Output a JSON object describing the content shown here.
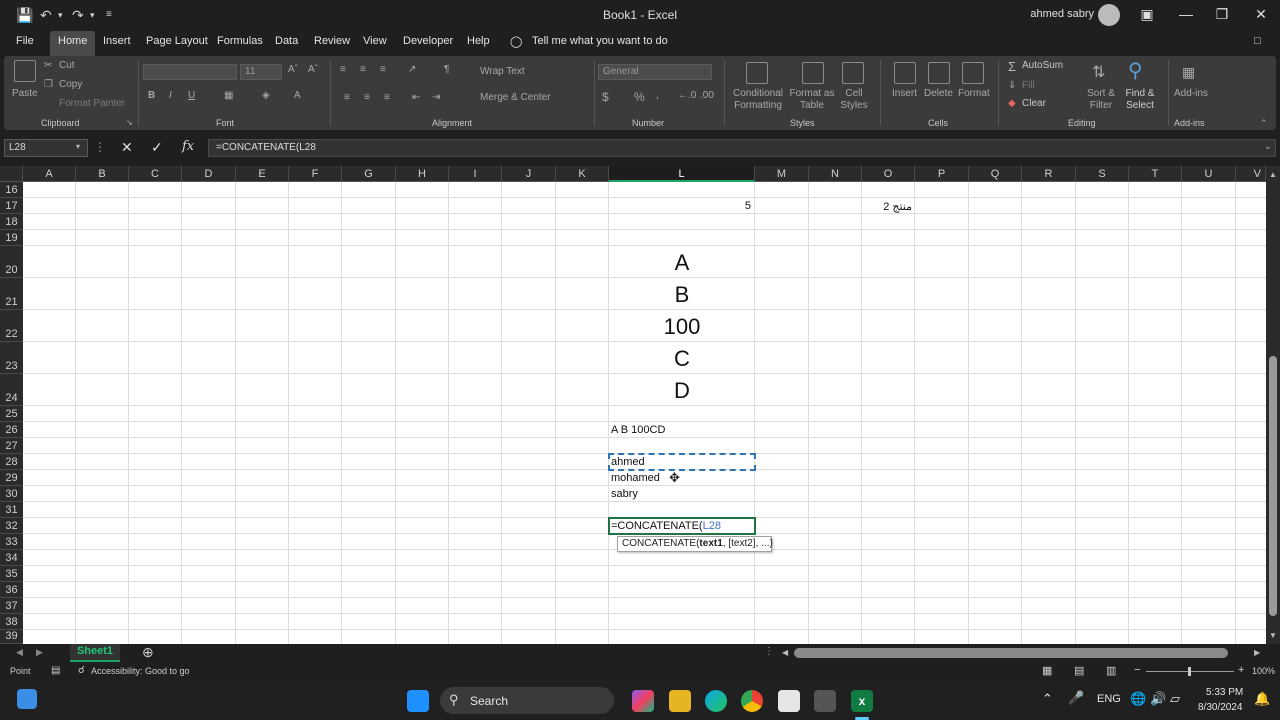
{
  "titlebar": {
    "title": "Book1  -  Excel",
    "user": "ahmed  sabry"
  },
  "tabs": [
    "File",
    "Home",
    "Insert",
    "Page Layout",
    "Formulas",
    "Data",
    "Review",
    "View",
    "Developer",
    "Help"
  ],
  "tell_me": "Tell me what you want to do",
  "ribbon": {
    "clipboard": {
      "paste": "Paste",
      "cut": "Cut",
      "copy": "Copy",
      "format_painter": "Format Painter",
      "label": "Clipboard"
    },
    "font": {
      "size": "11",
      "label": "Font"
    },
    "alignment": {
      "wrap": "Wrap Text",
      "merge": "Merge & Center",
      "label": "Alignment"
    },
    "number": {
      "format": "General",
      "label": "Number",
      "currency": "$",
      "percent": "%"
    },
    "styles": {
      "conditional": "Conditional Formatting",
      "format_table": "Format as Table",
      "cell_styles": "Cell Styles",
      "label": "Styles"
    },
    "cells": {
      "insert": "Insert",
      "delete": "Delete",
      "format": "Format",
      "label": "Cells"
    },
    "editing": {
      "autosum": "AutoSum",
      "fill": "Fill",
      "clear": "Clear",
      "sort": "Sort & Filter",
      "find": "Find & Select",
      "label": "Editing"
    },
    "addins": {
      "addins": "Add-ins",
      "label": "Add-ins"
    }
  },
  "formula_bar": {
    "name_box": "L28",
    "formula": "=CONCATENATE(L28"
  },
  "columns": [
    "A",
    "B",
    "C",
    "D",
    "E",
    "F",
    "G",
    "H",
    "I",
    "J",
    "K",
    "L",
    "M",
    "N",
    "O",
    "P",
    "Q",
    "R",
    "S",
    "T",
    "U",
    "V"
  ],
  "rows": [
    "16",
    "17",
    "18",
    "19",
    "20",
    "21",
    "22",
    "23",
    "24",
    "25",
    "26",
    "27",
    "28",
    "29",
    "30",
    "31",
    "32",
    "33",
    "34",
    "35",
    "36",
    "37",
    "38",
    "39"
  ],
  "cells": {
    "l17": "5",
    "o17": "منتج 2",
    "l20": "A",
    "l21": "B",
    "l22": "100",
    "l23": "C",
    "l24": "D",
    "l26": "A B 100CD",
    "l28": "ahmed",
    "l29": "mohamed",
    "l30": "sabry",
    "l32_prefix": "=CONCATENATE(",
    "l32_ref": "L28"
  },
  "tooltip": {
    "fn": "CONCATENATE(",
    "arg1": "text1",
    "rest": ", [text2], ...)"
  },
  "sheet_tab": "Sheet1",
  "status": {
    "mode": "Point",
    "accessibility": "Accessibility: Good to go",
    "zoom": "100%"
  },
  "taskbar": {
    "search": "Search",
    "lang": "ENG",
    "time": "5:33 PM",
    "date": "8/30/2024"
  },
  "colors": {
    "accent": "#21a366",
    "ref_blue": "#4472c4",
    "selection_dash": "#2e75b6"
  }
}
